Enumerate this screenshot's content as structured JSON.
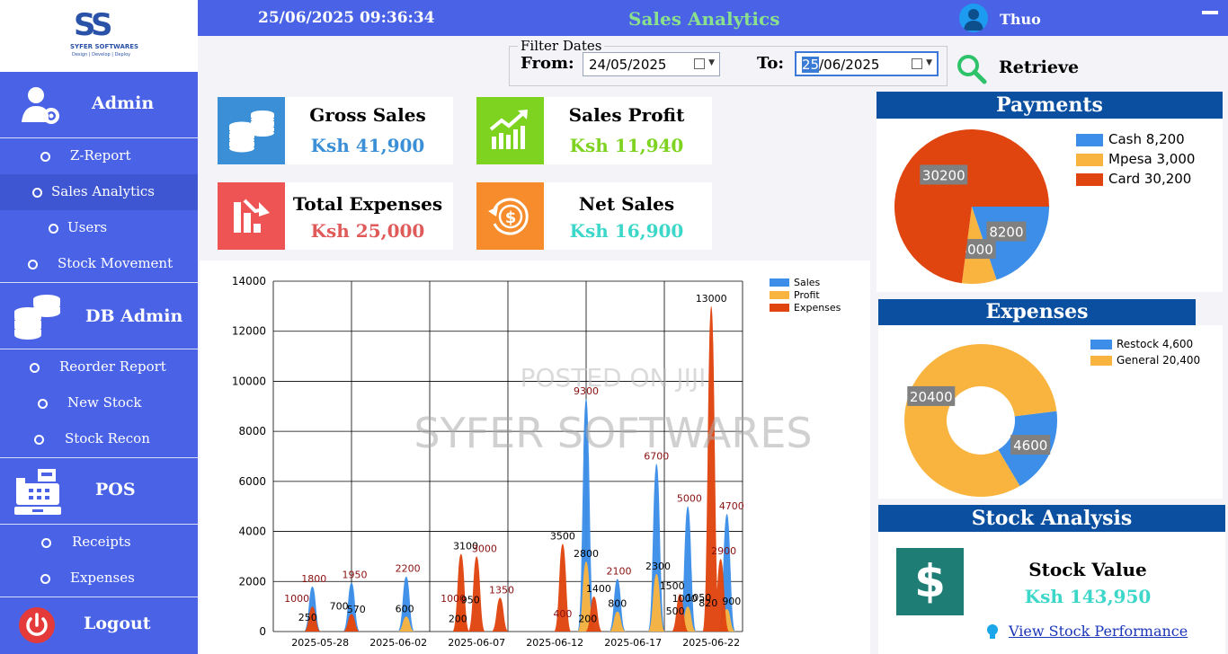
{
  "header": {
    "datetime": "25/06/2025  09:36:34",
    "title": "Sales Analytics",
    "user": "Thuo"
  },
  "logo": {
    "text": "SS",
    "name": "SYFER SOFTWARES",
    "tagline": "Design | Develop | Deploy"
  },
  "sidebar": {
    "sections": [
      {
        "title": "Admin",
        "icon": "admin-gear-icon"
      },
      {
        "title": "DB Admin",
        "icon": "database-icon"
      },
      {
        "title": "POS",
        "icon": "cash-register-icon"
      },
      {
        "title": "Logout",
        "icon": "power-icon"
      }
    ],
    "items": [
      {
        "label": "Z-Report",
        "active": false
      },
      {
        "label": "Sales Analytics",
        "active": true
      },
      {
        "label": "Users",
        "active": false
      },
      {
        "label": "Stock Movement",
        "active": false
      },
      {
        "label": "Reorder Report",
        "active": false
      },
      {
        "label": "New Stock",
        "active": false
      },
      {
        "label": "Stock Recon",
        "active": false
      },
      {
        "label": "Receipts",
        "active": false
      },
      {
        "label": "Expenses",
        "active": false
      }
    ]
  },
  "filter": {
    "legend": "Filter Dates",
    "from_label": "From:",
    "from_value": "24/05/2025",
    "to_label": "To:",
    "to_value_selected": "25",
    "to_value_rest": "/06/2025",
    "retrieve_label": "Retrieve"
  },
  "kpis": {
    "gross_sales": {
      "title": "Gross Sales",
      "value": "Ksh 41,900",
      "color": "#3a8fd6"
    },
    "sales_profit": {
      "title": "Sales Profit",
      "value": "Ksh 11,940",
      "color": "#7ed321"
    },
    "total_expenses": {
      "title": "Total Expenses",
      "value": "Ksh 25,000",
      "color": "#e05a5a"
    },
    "net_sales": {
      "title": "Net Sales",
      "value": "Ksh 16,900",
      "color": "#3cd7c9"
    }
  },
  "chart_data": {
    "type": "area",
    "y_ticks": [
      0,
      2000,
      4000,
      6000,
      8000,
      10000,
      12000,
      14000
    ],
    "ylim": [
      0,
      14000
    ],
    "x_tick_labels": [
      "2025-05-28",
      "2025-06-02",
      "2025-06-07",
      "2025-06-12",
      "2025-06-17",
      "2025-06-22"
    ],
    "grid": true,
    "legend_position": "top-right",
    "series": [
      {
        "name": "Sales",
        "color": "#3c8ee8",
        "peaks": [
          {
            "day": 2.5,
            "value": 1800
          },
          {
            "day": 5,
            "value": 1950
          },
          {
            "day": 8.5,
            "value": 2200
          },
          {
            "day": 12,
            "value": 200
          },
          {
            "day": 20,
            "value": 9300
          },
          {
            "day": 22,
            "value": 2100
          },
          {
            "day": 24.5,
            "value": 6700
          },
          {
            "day": 26.5,
            "value": 5000
          },
          {
            "day": 29,
            "value": 4700
          }
        ]
      },
      {
        "name": "Profit",
        "color": "#f9b440",
        "peaks": [
          {
            "day": 2.5,
            "value": 250
          },
          {
            "day": 5,
            "value": 570
          },
          {
            "day": 8.5,
            "value": 600
          },
          {
            "day": 12,
            "value": 950
          },
          {
            "day": 20,
            "value": 2800
          },
          {
            "day": 22,
            "value": 800
          },
          {
            "day": 24.5,
            "value": 2300
          },
          {
            "day": 26.5,
            "value": 1000
          },
          {
            "day": 29,
            "value": 900
          }
        ]
      },
      {
        "name": "Expenses",
        "color": "#e0450f",
        "peaks": [
          {
            "day": 2.5,
            "value": 1000
          },
          {
            "day": 5,
            "value": 700
          },
          {
            "day": 12,
            "value": 3100
          },
          {
            "day": 13,
            "value": 3000
          },
          {
            "day": 14.5,
            "value": 1350
          },
          {
            "day": 18.5,
            "value": 3500
          },
          {
            "day": 20.5,
            "value": 1400
          },
          {
            "day": 26,
            "value": 1500
          },
          {
            "day": 28,
            "value": 13000
          },
          {
            "day": 28.6,
            "value": 2900
          }
        ]
      }
    ],
    "data_labels": [
      {
        "day": 1.5,
        "value": 1000,
        "text": "1000",
        "c": "r"
      },
      {
        "day": 2.6,
        "value": 1800,
        "text": "1800",
        "c": "r"
      },
      {
        "day": 2.2,
        "value": 250,
        "text": "250",
        "c": "k"
      },
      {
        "day": 4.2,
        "value": 700,
        "text": "700",
        "c": "k"
      },
      {
        "day": 5.2,
        "value": 1950,
        "text": "1950",
        "c": "r"
      },
      {
        "day": 5.3,
        "value": 570,
        "text": "570",
        "c": "k"
      },
      {
        "day": 8.6,
        "value": 2200,
        "text": "2200",
        "c": "r"
      },
      {
        "day": 8.4,
        "value": 600,
        "text": "600",
        "c": "k"
      },
      {
        "day": 11.8,
        "value": 200,
        "text": "200",
        "c": "k"
      },
      {
        "day": 11.5,
        "value": 1000,
        "text": "1000",
        "c": "r"
      },
      {
        "day": 12.3,
        "value": 3100,
        "text": "3100",
        "c": "k"
      },
      {
        "day": 13.5,
        "value": 3000,
        "text": "3000",
        "c": "r"
      },
      {
        "day": 12.6,
        "value": 950,
        "text": "950",
        "c": "k"
      },
      {
        "day": 14.6,
        "value": 1350,
        "text": "1350",
        "c": "r"
      },
      {
        "day": 18.5,
        "value": 3500,
        "text": "3500",
        "c": "k"
      },
      {
        "day": 18.5,
        "value": 400,
        "text": "400",
        "c": "r"
      },
      {
        "day": 20,
        "value": 9300,
        "text": "9300",
        "c": "r"
      },
      {
        "day": 20,
        "value": 2800,
        "text": "2800",
        "c": "k"
      },
      {
        "day": 20.1,
        "value": 200,
        "text": "200",
        "c": "k"
      },
      {
        "day": 20.8,
        "value": 1400,
        "text": "1400",
        "c": "k"
      },
      {
        "day": 22.1,
        "value": 2100,
        "text": "2100",
        "c": "r"
      },
      {
        "day": 22,
        "value": 800,
        "text": "800",
        "c": "k"
      },
      {
        "day": 24.5,
        "value": 6700,
        "text": "6700",
        "c": "r"
      },
      {
        "day": 24.6,
        "value": 2300,
        "text": "2300",
        "c": "k"
      },
      {
        "day": 25.5,
        "value": 1500,
        "text": "1500",
        "c": "k"
      },
      {
        "day": 26.6,
        "value": 5000,
        "text": "5000",
        "c": "r"
      },
      {
        "day": 26.3,
        "value": 1000,
        "text": "1000",
        "c": "k"
      },
      {
        "day": 27.2,
        "value": 1050,
        "text": "1050",
        "c": "k"
      },
      {
        "day": 25.7,
        "value": 500,
        "text": "500",
        "c": "k"
      },
      {
        "day": 28,
        "value": 13000,
        "text": "13000",
        "c": "k"
      },
      {
        "day": 28.8,
        "value": 2900,
        "text": "2900",
        "c": "r"
      },
      {
        "day": 29.3,
        "value": 4700,
        "text": "4700",
        "c": "r"
      },
      {
        "day": 29.3,
        "value": 900,
        "text": "900",
        "c": "k"
      },
      {
        "day": 27.8,
        "value": 820,
        "text": "820",
        "c": "k"
      }
    ],
    "watermark_lines": [
      "POSTED ON JIJI",
      "SYFER SOFTWARES"
    ]
  },
  "payments": {
    "title": "Payments",
    "legend": [
      {
        "text": "Cash 8,200",
        "color": "#3c8ee8"
      },
      {
        "text": "Mpesa 3,000",
        "color": "#f9b440"
      },
      {
        "text": "Card 30,200",
        "color": "#e0450f"
      }
    ],
    "slices": [
      {
        "label": "8200",
        "value": 8200,
        "color": "#3c8ee8"
      },
      {
        "label": "3000",
        "value": 3000,
        "color": "#f9b440"
      },
      {
        "label": "30200",
        "value": 30200,
        "color": "#e0450f"
      }
    ]
  },
  "expenses": {
    "title": "Expenses",
    "legend": [
      {
        "text": "Restock 4,600",
        "color": "#3c8ee8"
      },
      {
        "text": "General 20,400",
        "color": "#f9b440"
      }
    ],
    "slices": [
      {
        "label": "4600",
        "value": 4600,
        "color": "#3c8ee8"
      },
      {
        "label": "20400",
        "value": 20400,
        "color": "#f9b440"
      }
    ]
  },
  "stock": {
    "section_title": "Stock Analysis",
    "title": "Stock Value",
    "value": "Ksh 143,950",
    "link": "View Stock Performance"
  }
}
